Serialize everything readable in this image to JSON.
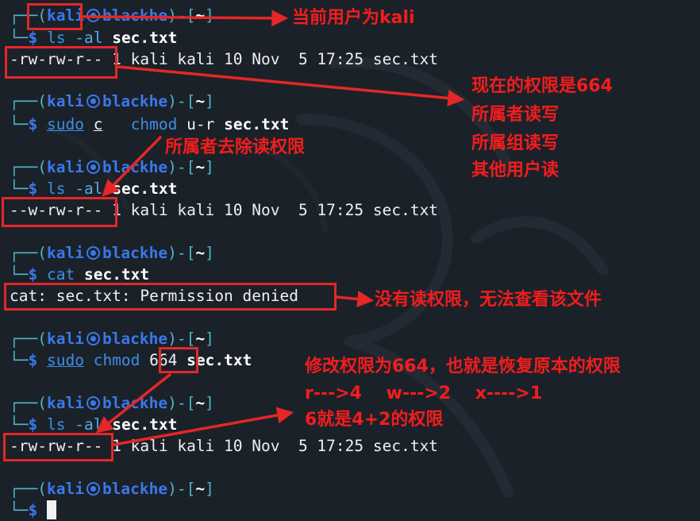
{
  "prompt": {
    "corner_top": "┌──",
    "corner_bottom": "└─",
    "open": "(",
    "user": "kali",
    "host": "blackhe",
    "close": ")-[",
    "dir": "~",
    "end": "]",
    "dollar": "$"
  },
  "lines": {
    "b1_cmd": "ls",
    "b1_opt": "-al",
    "b1_file": "sec.txt",
    "out1_perm": "-rw-rw-r--",
    "out1_rest": " 1 kali kali 10 Nov  5 17:25 sec.txt",
    "b2_sudo": "sudo",
    "b2_c": "c",
    "b2_space": "   ",
    "b2_chmod": "chmod",
    "b2_arg": "u-r",
    "b2_file": "sec.txt",
    "b3_cmd": "ls",
    "b3_opt": "-al",
    "b3_file": "sec.txt",
    "out3_perm": "--w-rw-r--",
    "out3_rest": " 1 kali kali 10 Nov  5 17:25 sec.txt",
    "b4_cmd": "cat",
    "b4_file": "sec.txt",
    "out4": "cat: sec.txt: Permission denied",
    "b5_sudo": "sudo",
    "b5_chmod": "chmod",
    "b5_num": "664",
    "b5_file": "sec.txt",
    "b6_cmd": "ls",
    "b6_opt": "-al",
    "b6_file": "sec.txt",
    "out6_perm": "-rw-rw-r--",
    "out6_rest": " 1 kali kali 10 Nov  5 17:25 sec.txt"
  },
  "notes": {
    "user": "当前用户为kali",
    "perm664_1": "现在的权限是664",
    "perm664_2": "所属者读写",
    "perm664_3": "所属组读写",
    "perm664_4": "其他用户读",
    "remove_read": "所属者去除读权限",
    "denied": "没有读权限，无法查看该文件",
    "restore_1": "修改权限为664，也就是恢复原本的权限",
    "restore_2": "r--->4    w--->2    x---->1",
    "restore_3": "6就是4+2的权限"
  },
  "colors": {
    "background": "#1b2129",
    "annotation": "#e52727",
    "user_host": "#3a78ea",
    "frame": "#4fb6c9"
  }
}
